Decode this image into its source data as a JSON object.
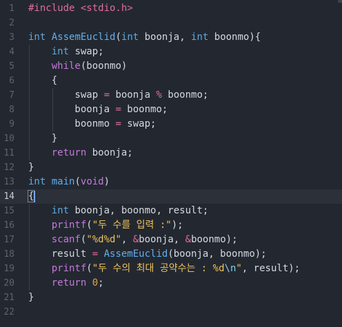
{
  "editor": {
    "current_line": 14,
    "lines": [
      {
        "n": "1",
        "tokens": [
          {
            "t": "#include <stdio.h>",
            "c": "pp"
          }
        ]
      },
      {
        "n": "2",
        "tokens": []
      },
      {
        "n": "3",
        "tokens": [
          {
            "t": "int",
            "c": "type"
          },
          {
            "t": " ",
            "c": "id"
          },
          {
            "t": "AssemEuclid",
            "c": "fn"
          },
          {
            "t": "(",
            "c": "id"
          },
          {
            "t": "int",
            "c": "type"
          },
          {
            "t": " boonja, ",
            "c": "id"
          },
          {
            "t": "int",
            "c": "type"
          },
          {
            "t": " boonmo){",
            "c": "id"
          }
        ]
      },
      {
        "n": "4",
        "tokens": [
          {
            "t": "    ",
            "c": "id"
          },
          {
            "t": "int",
            "c": "type"
          },
          {
            "t": " swap;",
            "c": "id"
          }
        ]
      },
      {
        "n": "5",
        "tokens": [
          {
            "t": "    ",
            "c": "id"
          },
          {
            "t": "while",
            "c": "kw"
          },
          {
            "t": "(boonmo)",
            "c": "id"
          }
        ]
      },
      {
        "n": "6",
        "tokens": [
          {
            "t": "    {",
            "c": "id"
          }
        ]
      },
      {
        "n": "7",
        "tokens": [
          {
            "t": "        swap ",
            "c": "id"
          },
          {
            "t": "=",
            "c": "op"
          },
          {
            "t": " boonja ",
            "c": "id"
          },
          {
            "t": "%",
            "c": "op"
          },
          {
            "t": " boonmo;",
            "c": "id"
          }
        ]
      },
      {
        "n": "8",
        "tokens": [
          {
            "t": "        boonja ",
            "c": "id"
          },
          {
            "t": "=",
            "c": "op"
          },
          {
            "t": " boonmo;",
            "c": "id"
          }
        ]
      },
      {
        "n": "9",
        "tokens": [
          {
            "t": "        boonmo ",
            "c": "id"
          },
          {
            "t": "=",
            "c": "op"
          },
          {
            "t": " swap;",
            "c": "id"
          }
        ]
      },
      {
        "n": "10",
        "tokens": [
          {
            "t": "    }",
            "c": "id"
          }
        ]
      },
      {
        "n": "11",
        "tokens": [
          {
            "t": "    ",
            "c": "id"
          },
          {
            "t": "return",
            "c": "kw"
          },
          {
            "t": " boonja;",
            "c": "id"
          }
        ]
      },
      {
        "n": "12",
        "tokens": [
          {
            "t": "}",
            "c": "id"
          }
        ]
      },
      {
        "n": "13",
        "tokens": [
          {
            "t": "int",
            "c": "type"
          },
          {
            "t": " ",
            "c": "id"
          },
          {
            "t": "main",
            "c": "fn"
          },
          {
            "t": "(",
            "c": "id"
          },
          {
            "t": "void",
            "c": "kw"
          },
          {
            "t": ")",
            "c": "id"
          }
        ]
      },
      {
        "n": "14",
        "tokens": [
          {
            "t": "{",
            "c": "id"
          }
        ]
      },
      {
        "n": "15",
        "tokens": [
          {
            "t": "    ",
            "c": "id"
          },
          {
            "t": "int",
            "c": "type"
          },
          {
            "t": " boonja, boonmo, result;",
            "c": "id"
          }
        ]
      },
      {
        "n": "16",
        "tokens": [
          {
            "t": "    ",
            "c": "id"
          },
          {
            "t": "printf",
            "c": "kw"
          },
          {
            "t": "(",
            "c": "id"
          },
          {
            "t": "\"두 수를 입력 :\"",
            "c": "str"
          },
          {
            "t": ");",
            "c": "id"
          }
        ]
      },
      {
        "n": "17",
        "tokens": [
          {
            "t": "    ",
            "c": "id"
          },
          {
            "t": "scanf",
            "c": "kw"
          },
          {
            "t": "(",
            "c": "id"
          },
          {
            "t": "\"%d%d\"",
            "c": "str"
          },
          {
            "t": ", ",
            "c": "id"
          },
          {
            "t": "&",
            "c": "op"
          },
          {
            "t": "boonja, ",
            "c": "id"
          },
          {
            "t": "&",
            "c": "op"
          },
          {
            "t": "boonmo);",
            "c": "id"
          }
        ]
      },
      {
        "n": "18",
        "tokens": [
          {
            "t": "    result ",
            "c": "id"
          },
          {
            "t": "=",
            "c": "op"
          },
          {
            "t": " ",
            "c": "id"
          },
          {
            "t": "AssemEuclid",
            "c": "fn"
          },
          {
            "t": "(boonja, boonmo);",
            "c": "id"
          }
        ]
      },
      {
        "n": "19",
        "tokens": [
          {
            "t": "    ",
            "c": "id"
          },
          {
            "t": "printf",
            "c": "kw"
          },
          {
            "t": "(",
            "c": "id"
          },
          {
            "t": "\"두 수의 최대 공약수는 : %d",
            "c": "str"
          },
          {
            "t": "\\n",
            "c": "esc"
          },
          {
            "t": "\"",
            "c": "str"
          },
          {
            "t": ", result);",
            "c": "id"
          }
        ]
      },
      {
        "n": "20",
        "tokens": [
          {
            "t": "    ",
            "c": "id"
          },
          {
            "t": "return",
            "c": "kw"
          },
          {
            "t": " ",
            "c": "id"
          },
          {
            "t": "0",
            "c": "num"
          },
          {
            "t": ";",
            "c": "id"
          }
        ]
      },
      {
        "n": "21",
        "tokens": [
          {
            "t": "}",
            "c": "id"
          }
        ]
      },
      {
        "n": "22",
        "tokens": []
      }
    ]
  },
  "colors": {
    "background": "#232830",
    "current_line": "#2b3039",
    "keyword": "#c678dd",
    "type": "#5fa8e0",
    "function": "#61afef",
    "string": "#ecc15c",
    "operator": "#e06c9a",
    "number": "#e5a04c"
  }
}
